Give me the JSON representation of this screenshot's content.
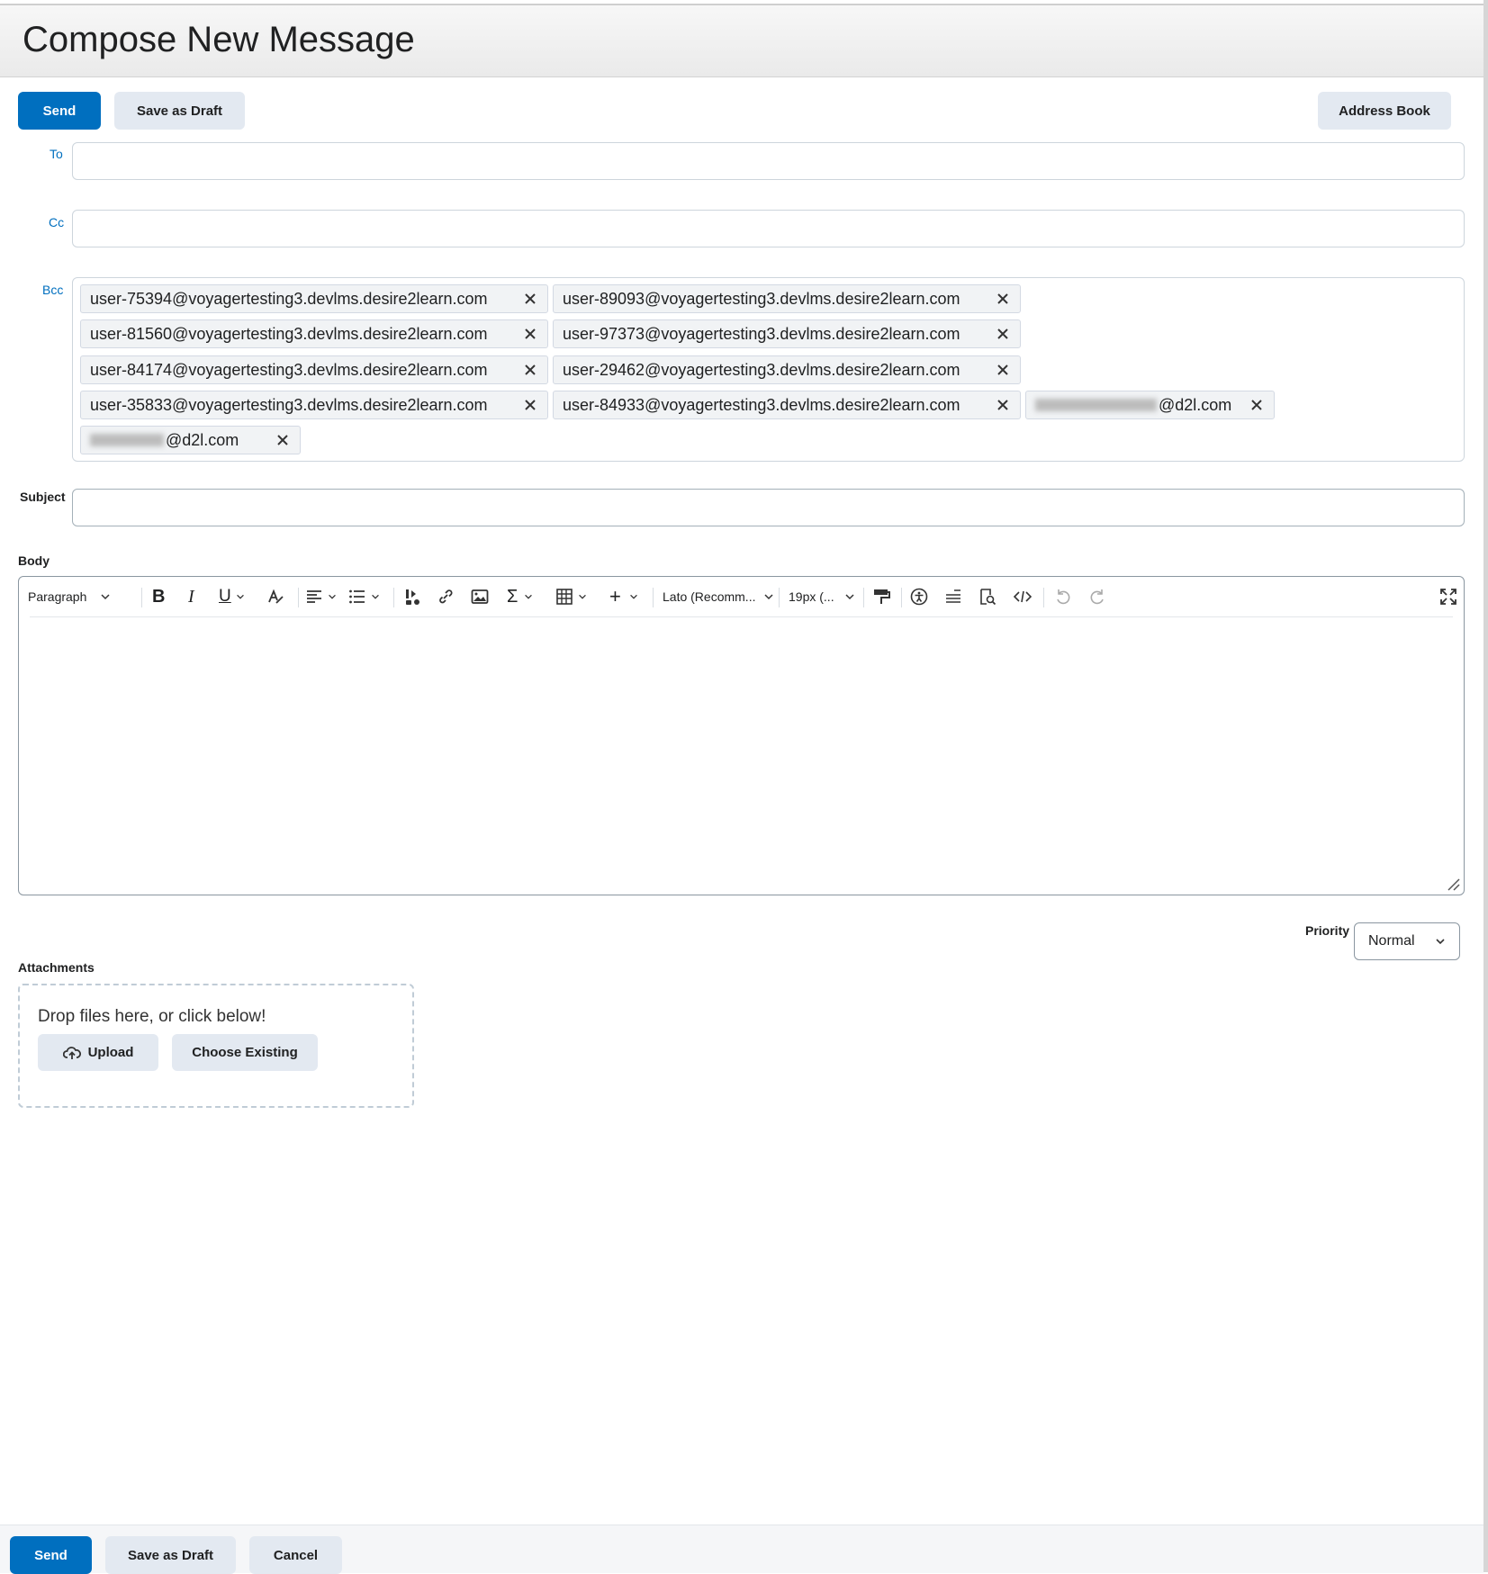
{
  "page": {
    "title": "Compose New Message"
  },
  "toolbar_top": {
    "send": "Send",
    "save_draft": "Save as Draft",
    "address_book": "Address Book"
  },
  "fields": {
    "to_label": "To",
    "to_value": "",
    "cc_label": "Cc",
    "cc_value": "",
    "bcc_label": "Bcc",
    "subject_label": "Subject",
    "subject_value": "",
    "body_label": "Body"
  },
  "bcc_recipients": [
    "user-75394@voyagertesting3.devlms.desire2learn.com",
    "user-89093@voyagertesting3.devlms.desire2learn.com",
    "user-81560@voyagertesting3.devlms.desire2learn.com",
    "user-97373@voyagertesting3.devlms.desire2learn.com",
    "user-84174@voyagertesting3.devlms.desire2learn.com",
    "user-29462@voyagertesting3.devlms.desire2learn.com",
    "user-35833@voyagertesting3.devlms.desire2learn.com",
    "user-84933@voyagertesting3.devlms.desire2learn.com",
    "@d2l.com",
    "@d2l.com"
  ],
  "editor": {
    "block_format": "Paragraph",
    "font_family": "Lato (Recomm...",
    "font_size": "19px (..."
  },
  "priority": {
    "label": "Priority",
    "value": "Normal"
  },
  "attachments": {
    "label": "Attachments",
    "drop_text": "Drop files here, or click below!",
    "upload": "Upload",
    "choose_existing": "Choose Existing"
  },
  "footer": {
    "send": "Send",
    "save_draft": "Save as Draft",
    "cancel": "Cancel"
  },
  "colors": {
    "primary": "#006fbf",
    "secondary_btn": "#e3e9f1",
    "link": "#006fbf"
  }
}
